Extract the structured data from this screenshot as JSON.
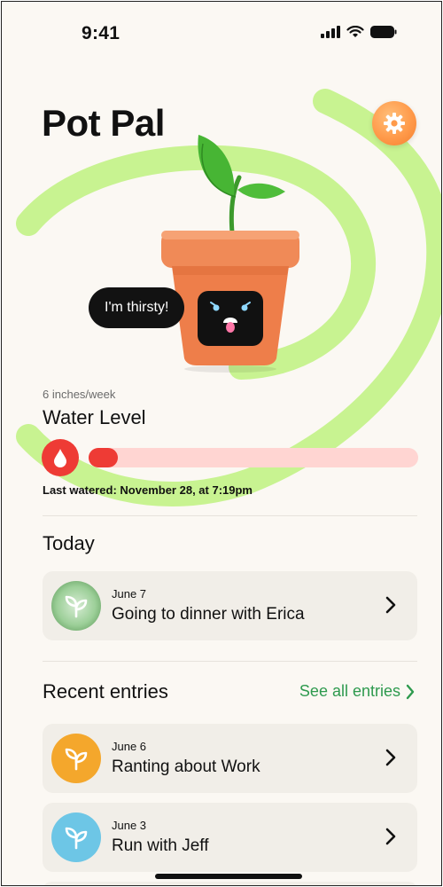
{
  "status_bar": {
    "time": "9:41"
  },
  "app": {
    "title": "Pot Pal"
  },
  "plant": {
    "speech": "I'm thirsty!"
  },
  "water": {
    "rate": "6 inches/week",
    "title": "Water Level",
    "level_fraction": 0.09,
    "last_watered": "Last watered: November 28, at 7:19pm"
  },
  "today": {
    "heading": "Today",
    "entry": {
      "date": "June 7",
      "title": "Going to dinner with Erica"
    }
  },
  "recent": {
    "heading": "Recent entries",
    "see_all_label": "See all entries",
    "entries": [
      {
        "date": "June 6",
        "title": "Ranting about Work",
        "icon": "leaf-icon",
        "color": "#f4a72c"
      },
      {
        "date": "June 3",
        "title": "Run with Jeff",
        "icon": "leaf-icon",
        "color": "#6dc6e6"
      }
    ]
  },
  "colors": {
    "accent_green": "#2e9a4e",
    "swirl_green": "#c8f391",
    "water_red": "#ee3b35",
    "water_track": "#ffd5d2",
    "settings_orange": "#ff9a4a"
  }
}
